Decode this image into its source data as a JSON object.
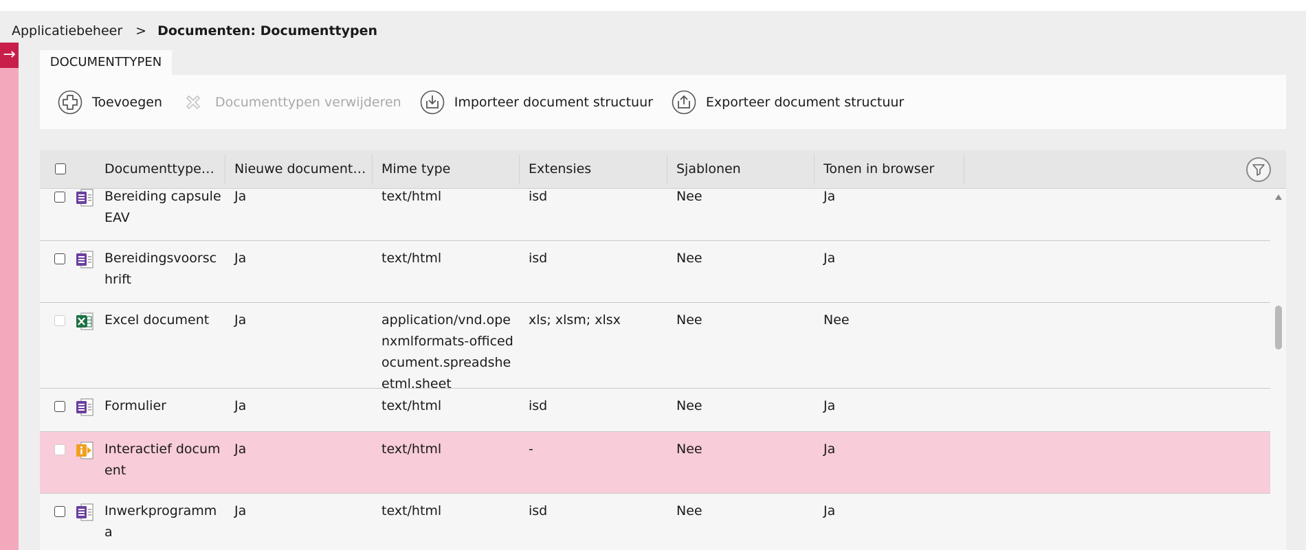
{
  "breadcrumb": {
    "parent": "Applicatiebeheer",
    "separator": ">",
    "current": "Documenten: Documenttypen"
  },
  "tab": {
    "label": "DOCUMENTTYPEN"
  },
  "toolbar": {
    "add_label": "Toevoegen",
    "delete_label": "Documenttypen verwijderen",
    "import_label": "Importeer document structuur",
    "export_label": "Exporteer document structuur"
  },
  "columns": {
    "documenttypen": "Documenttypen",
    "nieuwe": "Nieuwe document…",
    "mime": "Mime type",
    "extensies": "Extensies",
    "sjablonen": "Sjablonen",
    "tonen": "Tonen in browser"
  },
  "rows": [
    {
      "name": "Bereiding capsule EAV",
      "nieuw": "Ja",
      "mime": "text/html",
      "ext": "isd",
      "sjablonen": "Nee",
      "tonen": "Ja",
      "icon": "form-document-icon"
    },
    {
      "name": "Bereidingsvoorschrift",
      "nieuw": "Ja",
      "mime": "text/html",
      "ext": "isd",
      "sjablonen": "Nee",
      "tonen": "Ja",
      "icon": "form-document-icon"
    },
    {
      "name": "Excel document",
      "nieuw": "Ja",
      "mime": "application/vnd.openxmlformats-officedocument.spreadsheetml.sheet",
      "ext": "xls; xlsm; xlsx",
      "sjablonen": "Nee",
      "tonen": "Nee",
      "icon": "excel-document-icon"
    },
    {
      "name": "Formulier",
      "nieuw": "Ja",
      "mime": "text/html",
      "ext": "isd",
      "sjablonen": "Nee",
      "tonen": "Ja",
      "icon": "form-document-icon"
    },
    {
      "name": "Interactief document",
      "nieuw": "Ja",
      "mime": "text/html",
      "ext": "-",
      "sjablonen": "Nee",
      "tonen": "Ja",
      "icon": "interactive-document-icon"
    },
    {
      "name": "Inwerkprogramma",
      "nieuw": "Ja",
      "mime": "text/html",
      "ext": "isd",
      "sjablonen": "Nee",
      "tonen": "Ja",
      "icon": "form-document-icon"
    }
  ],
  "colors": {
    "accent": "#c71f4a",
    "rail": "#f3a8bc",
    "selected_row": "#f8ccd8",
    "form_icon": "#6b3fa0",
    "excel_icon": "#1e7145",
    "interactive_icon": "#f0a020"
  }
}
